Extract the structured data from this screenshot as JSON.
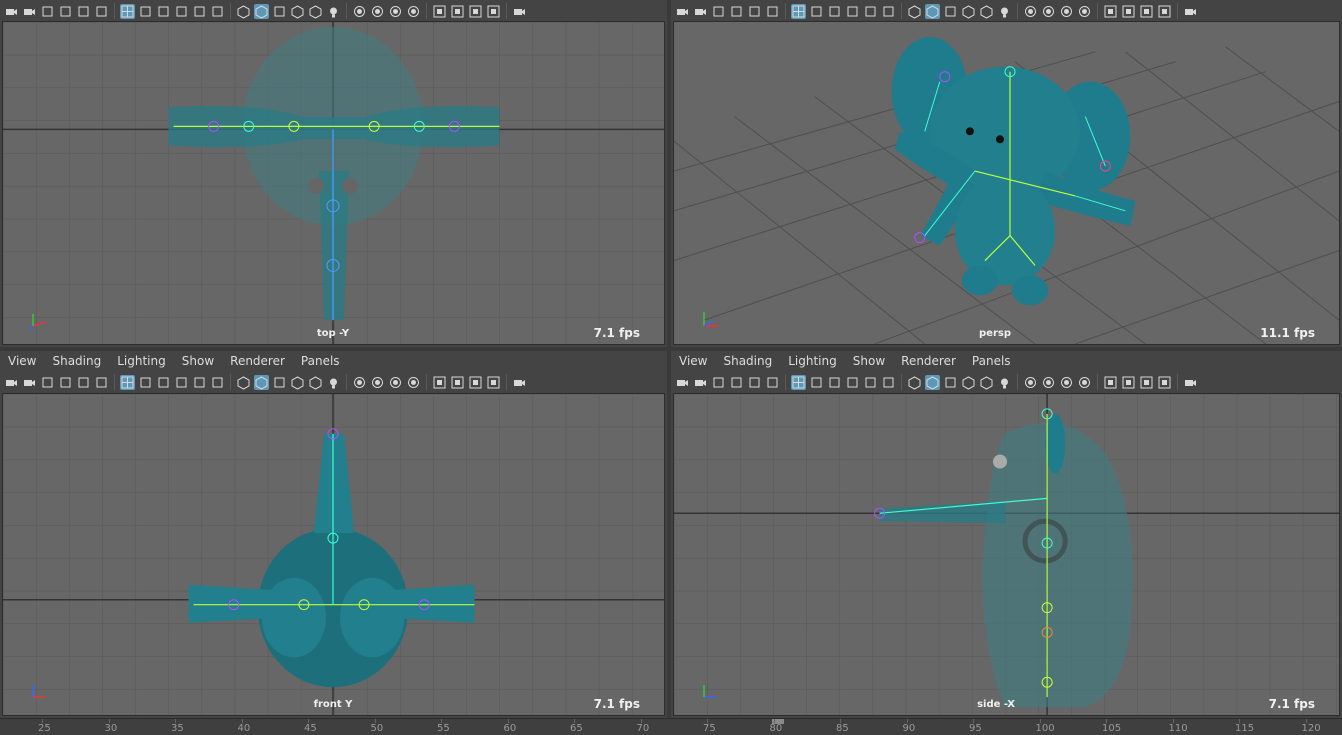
{
  "panels": {
    "top": {
      "camera": "top -Y",
      "fps": "7.1 fps"
    },
    "persp": {
      "camera": "persp",
      "fps": "11.1 fps"
    },
    "front": {
      "camera": "front Y",
      "fps": "7.1 fps"
    },
    "side": {
      "camera": "side -X",
      "fps": "7.1 fps"
    }
  },
  "menus": [
    "View",
    "Shading",
    "Lighting",
    "Show",
    "Renderer",
    "Panels"
  ],
  "axis_labels": {
    "x": "x",
    "y": "y",
    "z": "z"
  },
  "timeline": {
    "left_ticks": [
      "25",
      "30",
      "35",
      "40",
      "45",
      "50",
      "55",
      "60",
      "65",
      "70"
    ],
    "right_ticks": [
      "75",
      "80",
      "85",
      "90",
      "95",
      "100",
      "105",
      "110",
      "115",
      "120"
    ]
  },
  "colors": {
    "viewport_bg": "#676767",
    "grid": "#555555",
    "mesh": "#1f7c8c",
    "accent": "#5d98b8"
  }
}
